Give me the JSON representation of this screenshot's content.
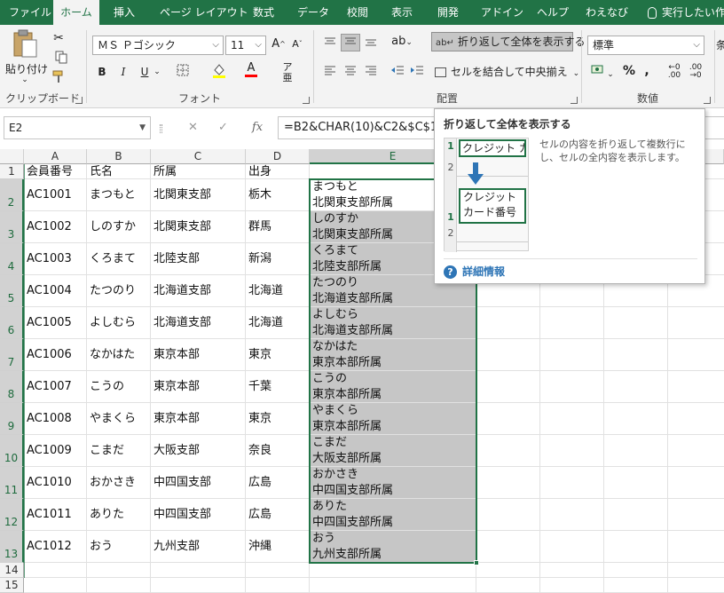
{
  "tabs": [
    "ファイル",
    "ホーム",
    "挿入",
    "ページ レイアウト",
    "数式",
    "データ",
    "校閲",
    "表示",
    "開発",
    "アドイン",
    "ヘルプ",
    "わえなび",
    "実行したい作"
  ],
  "active_tab": "ホーム",
  "ribbon": {
    "clipboard": {
      "paste_label": "貼り付け",
      "group_label": "クリップボード"
    },
    "font": {
      "font_name": "ＭＳ Ｐゴシック",
      "font_size": "11",
      "bold": "B",
      "italic": "I",
      "underline": "U",
      "group_label": "フォント",
      "font_color": "#ff0000",
      "fill_color": "#ffff00"
    },
    "alignment": {
      "wrap_text": "折り返して全体を表示する",
      "merge_center": "セルを結合して中央揃え",
      "group_label": "配置"
    },
    "number": {
      "format": "標準",
      "percent": "%",
      "comma": ",",
      "group_label": "数値",
      "cond_label": "条"
    }
  },
  "formula_bar": {
    "name_box": "E2",
    "cancel": "✕",
    "enter": "✓",
    "fx": "fx",
    "formula": "=B2&CHAR(10)&C2&$C$1"
  },
  "columns": [
    "A",
    "B",
    "C",
    "D",
    "E"
  ],
  "selected_column": "E",
  "rows": [
    {
      "n": "1",
      "A": "会員番号",
      "B": "氏名",
      "C": "所属",
      "D": "出身",
      "E": ""
    },
    {
      "n": "2",
      "A": "AC1001",
      "B": "まつもと",
      "C": "北関東支部",
      "D": "栃木",
      "E": [
        "まつもと",
        "北関東支部所属"
      ]
    },
    {
      "n": "3",
      "A": "AC1002",
      "B": "しのすか",
      "C": "北関東支部",
      "D": "群馬",
      "E": [
        "しのすか",
        "北関東支部所属"
      ]
    },
    {
      "n": "4",
      "A": "AC1003",
      "B": "くろまて",
      "C": "北陸支部",
      "D": "新潟",
      "E": [
        "くろまて",
        "北陸支部所属"
      ]
    },
    {
      "n": "5",
      "A": "AC1004",
      "B": "たつのり",
      "C": "北海道支部",
      "D": "北海道",
      "E": [
        "たつのり",
        "北海道支部所属"
      ]
    },
    {
      "n": "6",
      "A": "AC1005",
      "B": "よしむら",
      "C": "北海道支部",
      "D": "北海道",
      "E": [
        "よしむら",
        "北海道支部所属"
      ]
    },
    {
      "n": "7",
      "A": "AC1006",
      "B": "なかはた",
      "C": "東京本部",
      "D": "東京",
      "E": [
        "なかはた",
        "東京本部所属"
      ]
    },
    {
      "n": "8",
      "A": "AC1007",
      "B": "こうの",
      "C": "東京本部",
      "D": "千葉",
      "E": [
        "こうの",
        "東京本部所属"
      ]
    },
    {
      "n": "9",
      "A": "AC1008",
      "B": "やまくら",
      "C": "東京本部",
      "D": "東京",
      "E": [
        "やまくら",
        "東京本部所属"
      ]
    },
    {
      "n": "10",
      "A": "AC1009",
      "B": "こまだ",
      "C": "大阪支部",
      "D": "奈良",
      "E": [
        "こまだ",
        "大阪支部所属"
      ]
    },
    {
      "n": "11",
      "A": "AC1010",
      "B": "おかさき",
      "C": "中四国支部",
      "D": "広島",
      "E": [
        "おかさき",
        "中四国支部所属"
      ]
    },
    {
      "n": "12",
      "A": "AC1011",
      "B": "ありた",
      "C": "中四国支部",
      "D": "広島",
      "E": [
        "ありた",
        "中四国支部所属"
      ]
    },
    {
      "n": "13",
      "A": "AC1012",
      "B": "おう",
      "C": "九州支部",
      "D": "沖縄",
      "E": [
        "おう",
        "九州支部所属"
      ]
    },
    {
      "n": "14",
      "A": "",
      "B": "",
      "C": "",
      "D": "",
      "E": ""
    },
    {
      "n": "15",
      "A": "",
      "B": "",
      "C": "",
      "D": "",
      "E": ""
    }
  ],
  "tooltip": {
    "title": "折り返して全体を表示する",
    "preview_top_row": "1",
    "preview_top_cell": "クレジット カ",
    "preview_row2": "2",
    "preview_bottom_row": "1",
    "preview_bottom_line1": "クレジット",
    "preview_bottom_line2": "カード番号",
    "preview_bottom_row2": "2",
    "description": "セルの内容を折り返して複数行にし、セルの全内容を表示します。",
    "more_info": "詳細情報"
  },
  "colors": {
    "excel_green": "#217346",
    "selection_fill": "#c6c6c6",
    "accent_blue": "#2e75b6"
  }
}
